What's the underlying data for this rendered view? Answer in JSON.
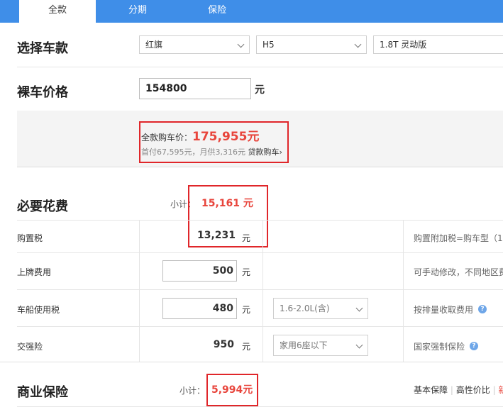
{
  "tabs": [
    {
      "label": "全款",
      "active": true
    },
    {
      "label": "分期",
      "active": false
    },
    {
      "label": "保险",
      "active": false
    }
  ],
  "car_select": {
    "title": "选择车款",
    "brand": "红旗",
    "model": "H5",
    "trim": "1.8T 灵动版"
  },
  "bare_price": {
    "title": "裸车价格",
    "value": "154800",
    "unit": "元"
  },
  "summary": {
    "full_label": "全款购车价：",
    "full_price": "175,955元",
    "loan_text": "首付67,595元，月供3,316元",
    "loan_link": "贷款购车",
    "loan_arrow": "›"
  },
  "required": {
    "title": "必要花费",
    "subtotal_label": "小计：",
    "subtotal_value": "15,161 元",
    "rows": [
      {
        "label": "购置税",
        "value": "13,231",
        "unit": "元",
        "note": "购置附加税=购车型（1-"
      },
      {
        "label": "上牌费用",
        "value": "500",
        "unit": "元",
        "note": "可手动修改，不同地区费"
      },
      {
        "label": "车船使用税",
        "value": "480",
        "unit": "元",
        "select": "1.6-2.0L(含)",
        "note": "按排量收取费用"
      },
      {
        "label": "交强险",
        "value": "950",
        "unit": "元",
        "select": "家用6座以下",
        "note": "国家强制保险"
      }
    ]
  },
  "insurance": {
    "title": "商业保险",
    "subtotal_label": "小计：",
    "subtotal_value": "5,994元",
    "options": [
      "基本保障",
      "|",
      "高性价比",
      "|",
      "新"
    ]
  },
  "colors": {
    "tab_blue": "#3f8ee8",
    "highlight_red": "#e8453c",
    "annotation_red": "#e0262a"
  },
  "icons": {
    "help": "?"
  }
}
